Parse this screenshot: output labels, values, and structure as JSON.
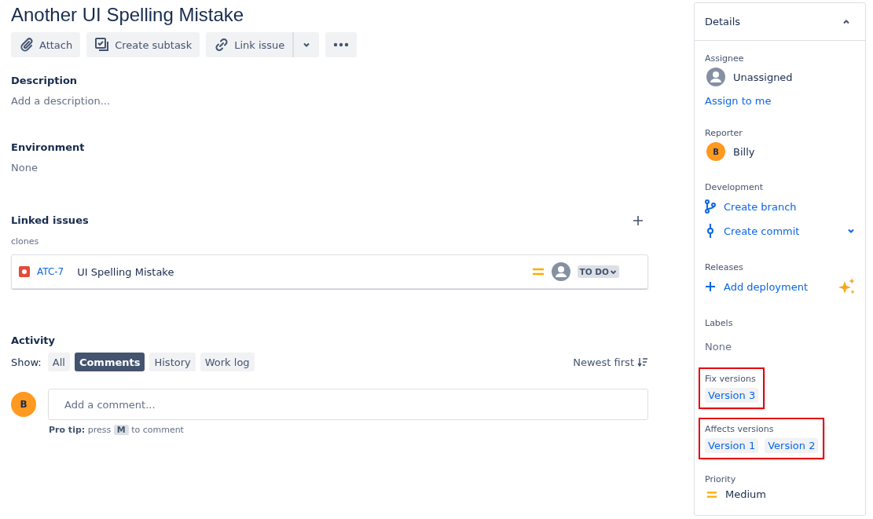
{
  "title": "Another UI Spelling Mistake",
  "toolbar": [
    {
      "kind": "attach",
      "label": "Attach"
    },
    {
      "kind": "subtask",
      "label": "Create subtask"
    },
    {
      "kind": "link",
      "label": "Link issue"
    }
  ],
  "description": {
    "label": "Description",
    "placeholder": "Add a description..."
  },
  "environment": {
    "label": "Environment",
    "value": "None"
  },
  "linked_issues": {
    "label": "Linked issues",
    "relation": "clones",
    "issues": [
      {
        "key": "ATC-7",
        "summary": "UI Spelling Mistake",
        "status": "TO DO"
      }
    ]
  },
  "activity": {
    "label": "Activity",
    "show_label": "Show:",
    "filters": [
      {
        "label": "All",
        "selected": false
      },
      {
        "label": "Comments",
        "selected": true
      },
      {
        "label": "History",
        "selected": false
      },
      {
        "label": "Work log",
        "selected": false
      }
    ],
    "sort": "Newest first",
    "avatar": "B",
    "comment_placeholder": "Add a comment...",
    "tip": {
      "bold": "Pro tip:",
      "before": "press",
      "key": "M",
      "after": "to comment"
    }
  },
  "details": {
    "title": "Details",
    "fields": [
      {
        "kind": "assignee",
        "label": "Assignee",
        "value": "Unassigned",
        "link": "Assign to me",
        "highlighted": false
      },
      {
        "kind": "reporter",
        "label": "Reporter",
        "avatar": "B",
        "value": "Billy",
        "highlighted": false
      },
      {
        "kind": "development",
        "label": "Development",
        "links": [
          {
            "label": "Create branch",
            "dropdown": false
          },
          {
            "label": "Create commit",
            "dropdown": true
          }
        ],
        "highlighted": false
      },
      {
        "kind": "releases",
        "label": "Releases",
        "link": "Add deployment",
        "highlighted": false
      },
      {
        "kind": "plain",
        "label": "Labels",
        "value": "None",
        "highlighted": false
      },
      {
        "kind": "versions",
        "label": "Fix versions",
        "versions": [
          "Version 3"
        ],
        "highlighted": true
      },
      {
        "kind": "versions",
        "label": "Affects versions",
        "versions": [
          "Version 1",
          "Version 2"
        ],
        "highlighted": true
      },
      {
        "kind": "priority",
        "label": "Priority",
        "value": "Medium",
        "highlighted": false
      }
    ]
  }
}
